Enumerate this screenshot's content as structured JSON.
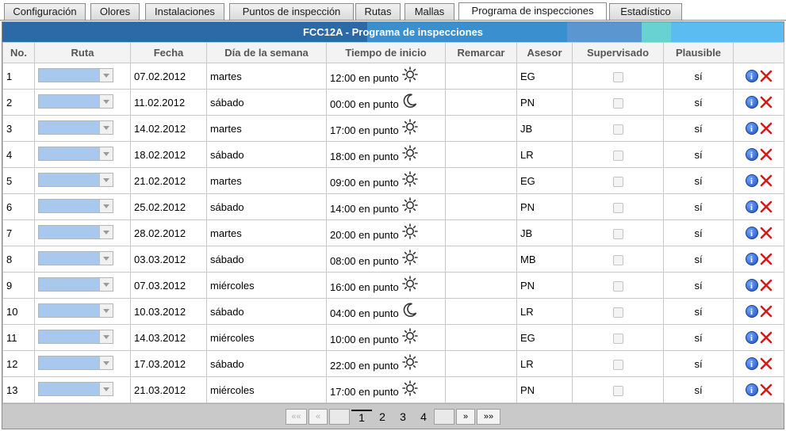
{
  "tabs": [
    {
      "label": "Configuración",
      "active": false
    },
    {
      "label": "Olores",
      "active": false
    },
    {
      "label": "Instalaciones",
      "active": false
    },
    {
      "label": "Puntos de inspección",
      "active": false
    },
    {
      "label": "Rutas",
      "active": false
    },
    {
      "label": "Mallas",
      "active": false
    },
    {
      "label": "Programa de inspecciones",
      "active": true
    },
    {
      "label": "Estadístico",
      "active": false
    }
  ],
  "panel": {
    "title": "FCC12A - Programa de inspecciones",
    "title_colors": [
      "#2b6aa6",
      "#3a8fcf",
      "#5b96d0",
      "#68d1d1",
      "#5bbcf2"
    ]
  },
  "table": {
    "headers": [
      "No.",
      "Ruta",
      "Fecha",
      "Día de la semana",
      "Tiempo de inicio",
      "Remarcar",
      "Asesor",
      "Supervisado",
      "Plausible",
      ""
    ],
    "rows": [
      {
        "no": "1",
        "date": "07.02.2012",
        "day": "martes",
        "time": "12:00 en punto",
        "icon": "sun-icon",
        "advisor": "EG",
        "supervised": false,
        "plausible": "sí"
      },
      {
        "no": "2",
        "date": "11.02.2012",
        "day": "sábado",
        "time": "00:00 en punto",
        "icon": "moon-icon",
        "advisor": "PN",
        "supervised": false,
        "plausible": "sí"
      },
      {
        "no": "3",
        "date": "14.02.2012",
        "day": "martes",
        "time": "17:00 en punto",
        "icon": "sun-icon",
        "advisor": "JB",
        "supervised": false,
        "plausible": "sí"
      },
      {
        "no": "4",
        "date": "18.02.2012",
        "day": "sábado",
        "time": "18:00 en punto",
        "icon": "sun-icon",
        "advisor": "LR",
        "supervised": false,
        "plausible": "sí"
      },
      {
        "no": "5",
        "date": "21.02.2012",
        "day": "martes",
        "time": "09:00 en punto",
        "icon": "sun-icon",
        "advisor": "EG",
        "supervised": false,
        "plausible": "sí"
      },
      {
        "no": "6",
        "date": "25.02.2012",
        "day": "sábado",
        "time": "14:00 en punto",
        "icon": "sun-icon",
        "advisor": "PN",
        "supervised": false,
        "plausible": "sí"
      },
      {
        "no": "7",
        "date": "28.02.2012",
        "day": "martes",
        "time": "20:00 en punto",
        "icon": "sun-icon",
        "advisor": "JB",
        "supervised": false,
        "plausible": "sí"
      },
      {
        "no": "8",
        "date": "03.03.2012",
        "day": "sábado",
        "time": "08:00 en punto",
        "icon": "sun-icon",
        "advisor": "MB",
        "supervised": false,
        "plausible": "sí"
      },
      {
        "no": "9",
        "date": "07.03.2012",
        "day": "miércoles",
        "time": "16:00 en punto",
        "icon": "sun-icon",
        "advisor": "PN",
        "supervised": false,
        "plausible": "sí"
      },
      {
        "no": "10",
        "date": "10.03.2012",
        "day": "sábado",
        "time": "04:00 en punto",
        "icon": "moon-icon",
        "advisor": "LR",
        "supervised": false,
        "plausible": "sí"
      },
      {
        "no": "11",
        "date": "14.03.2012",
        "day": "miércoles",
        "time": "10:00 en punto",
        "icon": "sun-icon",
        "advisor": "EG",
        "supervised": false,
        "plausible": "sí"
      },
      {
        "no": "12",
        "date": "17.03.2012",
        "day": "sábado",
        "time": "22:00 en punto",
        "icon": "sun-icon",
        "advisor": "LR",
        "supervised": false,
        "plausible": "sí"
      },
      {
        "no": "13",
        "date": "21.03.2012",
        "day": "miércoles",
        "time": "17:00 en punto",
        "icon": "sun-icon",
        "advisor": "PN",
        "supervised": false,
        "plausible": "sí"
      }
    ]
  },
  "pager": {
    "first": "««",
    "prev": "«",
    "pages": [
      "1",
      "2",
      "3",
      "4"
    ],
    "current": "1",
    "next": "»",
    "last": "»»"
  },
  "colors": {
    "delete": "#d61a1a",
    "info": "#1f4fbf",
    "route_select": "#a9c8ee"
  }
}
